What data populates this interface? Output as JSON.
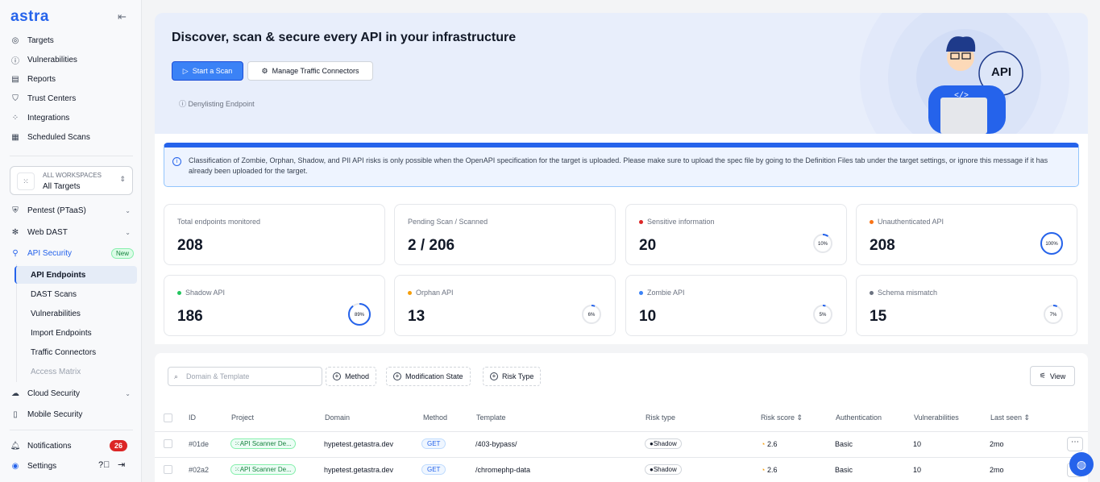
{
  "app": {
    "logo": "astra",
    "collapse_icon": "collapse-sidebar-icon"
  },
  "sidebar": {
    "top_items": [
      {
        "label": "Targets",
        "icon": "target-icon"
      },
      {
        "label": "Vulnerabilities",
        "icon": "alert-circle-icon"
      },
      {
        "label": "Reports",
        "icon": "document-icon"
      },
      {
        "label": "Trust Centers",
        "icon": "shield-icon"
      },
      {
        "label": "Integrations",
        "icon": "integrations-icon"
      },
      {
        "label": "Scheduled Scans",
        "icon": "calendar-icon"
      }
    ],
    "workspace": {
      "label": "ALL WORKSPACES",
      "value": "All Targets"
    },
    "sections": [
      {
        "label": "Pentest (PTaaS)",
        "icon": "shield-check-icon"
      },
      {
        "label": "Web DAST",
        "icon": "bug-icon"
      },
      {
        "label": "API Security",
        "icon": "api-tree-icon",
        "badge": "New"
      }
    ],
    "api_sub": [
      "API Endpoints",
      "DAST Scans",
      "Vulnerabilities",
      "Import Endpoints",
      "Traffic Connectors",
      "Access Matrix"
    ],
    "lower": [
      {
        "label": "Cloud Security",
        "icon": "cloud-icon"
      },
      {
        "label": "Mobile Security",
        "icon": "mobile-icon"
      }
    ],
    "notifications": {
      "label": "Notifications",
      "count": "26"
    },
    "settings": {
      "label": "Settings"
    }
  },
  "hero": {
    "title": "Discover, scan & secure every API in your infrastructure",
    "start_scan": "Start a Scan",
    "manage_connectors": "Manage Traffic Connectors",
    "denylisting": "Denylisting Endpoint",
    "illustration_text": "API"
  },
  "info_banner": "Classification of Zombie, Orphan, Shadow, and PII API risks is only possible when the OpenAPI specification for the target is uploaded. Please make sure to upload the spec file by going to the Definition Files tab under the target settings, or ignore this message if it has already been uploaded for the target.",
  "stats": [
    {
      "label": "Total endpoints monitored",
      "value": "208"
    },
    {
      "label": "Pending Scan / Scanned",
      "value": "2 / 206"
    },
    {
      "label": "Sensitive information",
      "value": "20",
      "percent": 10,
      "pct_label": "10%",
      "color": "#dc2626"
    },
    {
      "label": "Unauthenticated API",
      "value": "208",
      "percent": 100,
      "pct_label": "100%",
      "color": "#f97316"
    },
    {
      "label": "Shadow API",
      "value": "186",
      "percent": 89,
      "pct_label": "89%",
      "color": "#22c55e"
    },
    {
      "label": "Orphan API",
      "value": "13",
      "percent": 6,
      "pct_label": "6%",
      "color": "#f59e0b"
    },
    {
      "label": "Zombie API",
      "value": "10",
      "percent": 5,
      "pct_label": "5%",
      "color": "#3b82f6"
    },
    {
      "label": "Schema mismatch",
      "value": "15",
      "percent": 7,
      "pct_label": "7%",
      "color": "#6b7280"
    }
  ],
  "toolbar": {
    "search_placeholder": "Domain & Template",
    "filters": [
      "Method",
      "Modification State",
      "Risk Type"
    ],
    "view": "View"
  },
  "table": {
    "headers": [
      "ID",
      "Project",
      "Domain",
      "Method",
      "Template",
      "Risk type",
      "Risk score",
      "Authentication",
      "Vulnerabilities",
      "Last seen"
    ],
    "rows": [
      {
        "id": "#01de",
        "project": "API Scanner De...",
        "domain": "hypetest.getastra.dev",
        "method": "GET",
        "template": "/403-bypass/",
        "risk_type": "Shadow",
        "risk_score": "2.6",
        "auth": "Basic",
        "vulns": "10",
        "last_seen": "2mo"
      },
      {
        "id": "#02a2",
        "project": "API Scanner De...",
        "domain": "hypetest.getastra.dev",
        "method": "GET",
        "template": "/chromephp-data",
        "risk_type": "Shadow",
        "risk_score": "2.6",
        "auth": "Basic",
        "vulns": "10",
        "last_seen": "2mo"
      }
    ]
  }
}
